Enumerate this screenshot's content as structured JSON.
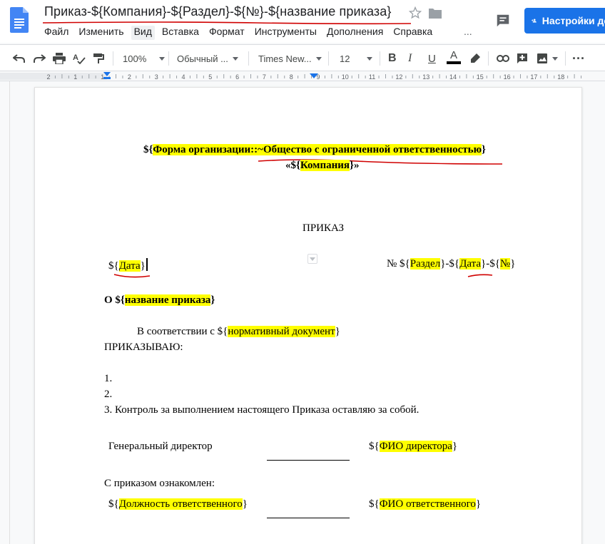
{
  "header": {
    "title": "Приказ-${Компания}-${Раздел}-${№}-${название приказа}",
    "share_label": "Настройки до",
    "menu": [
      "Файл",
      "Изменить",
      "Вид",
      "Вставка",
      "Формат",
      "Инструменты",
      "Дополнения",
      "Справка"
    ],
    "menu_more": "...",
    "icons": [
      "docs-logo-icon",
      "star-icon",
      "folder-icon",
      "comment-icon",
      "person-add-icon"
    ]
  },
  "toolbar": {
    "zoom": "100%",
    "style": "Обычный ...",
    "font": "Times New...",
    "size": "12",
    "more": "⋮"
  },
  "ruler": {
    "numbers": [
      "2",
      "1",
      "1",
      "2",
      "3",
      "4",
      "5",
      "6",
      "7",
      "8",
      "9",
      "10",
      "11",
      "12",
      "13",
      "14",
      "15",
      "16",
      "17",
      "18"
    ]
  },
  "document": {
    "org_open": "${",
    "org_hl": "Форма организации::~Общество с ограниченной ответственностью",
    "org_close": "}",
    "company_open": "«${",
    "company_hl": "Компания",
    "company_close": "}»",
    "order_heading": "ПРИКАЗ",
    "date_open": "${",
    "date_hl": "Дата",
    "date_close": "}",
    "num_prefix": "№  ${",
    "num_razdel": "Раздел",
    "num_mid1": "}-${",
    "num_date": "Дата",
    "num_mid2": "}-${",
    "num_no": "№",
    "num_close": "}",
    "subject_prefix": "О ${",
    "subject_hl": "название приказа",
    "subject_close": "}",
    "basis_prefix": "В соответствии с   ${",
    "basis_hl": "нормативный документ",
    "basis_close": "}",
    "order_word": "ПРИКАЗЫВАЮ:",
    "item1": "1.",
    "item2": "2.",
    "item3": "3. Контроль за выполнением настоящего Приказа оставляю за собой.",
    "director_label": "Генеральный директор",
    "director_open": "${",
    "director_hl": "ФИО директора",
    "director_close": "}",
    "acquainted": "С приказом ознакомлен:",
    "resp_pos_open": "${",
    "resp_pos_hl": "Должность ответственного",
    "resp_pos_close": "}",
    "resp_name_open": "${",
    "resp_name_hl": "ФИО ответственного",
    "resp_name_close": "}"
  },
  "colors": {
    "highlight": "#ffff00",
    "accent": "#1a73e8",
    "annotation": "#d00000"
  }
}
